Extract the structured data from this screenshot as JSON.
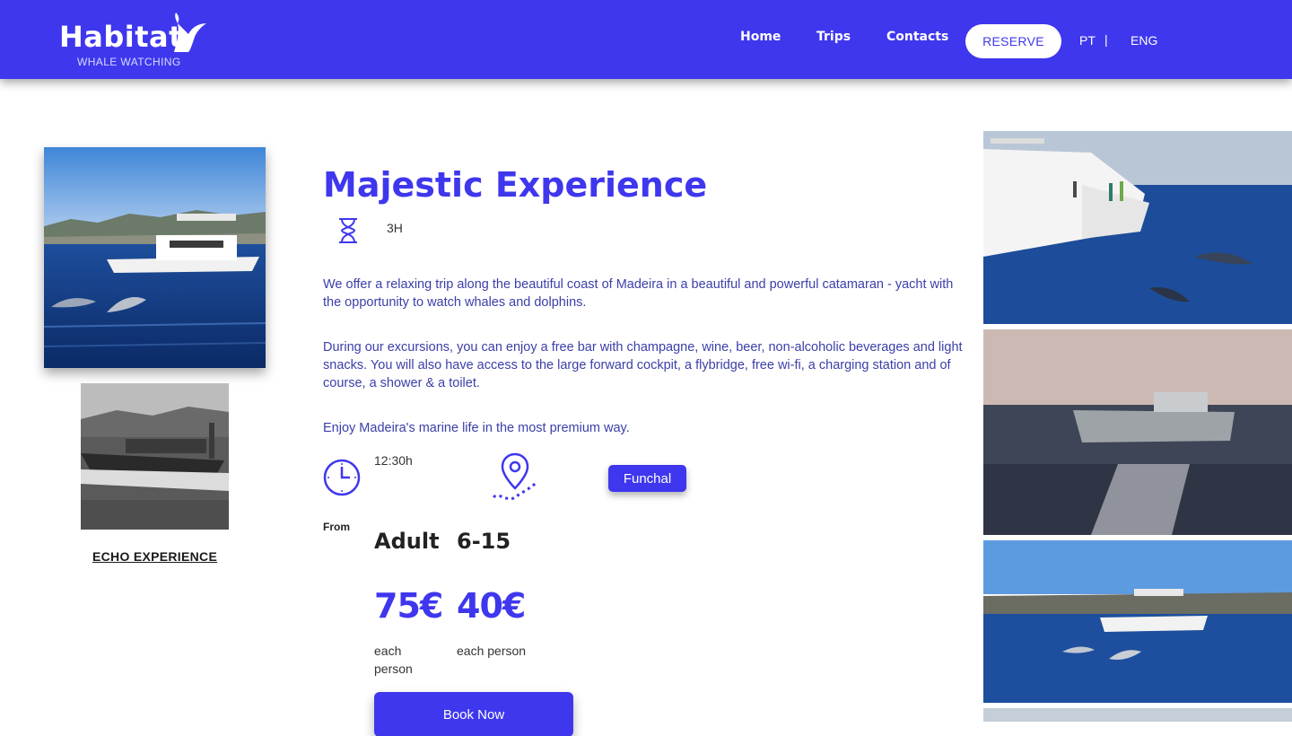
{
  "header": {
    "logo_text": "Habitat",
    "logo_sub": "WHALE WATCHING",
    "nav": [
      "Home",
      "Trips",
      "Contacts"
    ],
    "reserve": "RESERVE",
    "lang_pt": "PT",
    "lang_sep": "|",
    "lang_eng": "ENG"
  },
  "left": {
    "related_link": "ECHO EXPERIENCE"
  },
  "trip": {
    "title": "Majestic Experience",
    "duration": "3H",
    "paragraphs": [
      "We offer a relaxing trip along the beautiful coast of Madeira in a beautiful and powerful catamaran - yacht with the opportunity to watch whales and dolphins.",
      "During our excursions, you can enjoy a free bar with champagne, wine, beer, non-alcoholic beverages and light snacks. You will also have access to the large forward cockpit, a flybridge, free wi-fi, a charging station and of course, a shower & a toilet.",
      "Enjoy Madeira's marine life in the most premium way."
    ],
    "time": "12:30h",
    "location": "Funchal",
    "from_label": "From",
    "prices": [
      {
        "label": "Adult",
        "value": "75€",
        "note": "each person"
      },
      {
        "label": "6-15",
        "value": "40€",
        "note": "each person"
      }
    ],
    "book": "Book Now"
  },
  "icons": {
    "duration": "hourglass-icon",
    "time": "clock-icon",
    "location": "map-pin-icon"
  },
  "colors": {
    "brand": "#3f37ee",
    "text": "#3b3fa8"
  }
}
